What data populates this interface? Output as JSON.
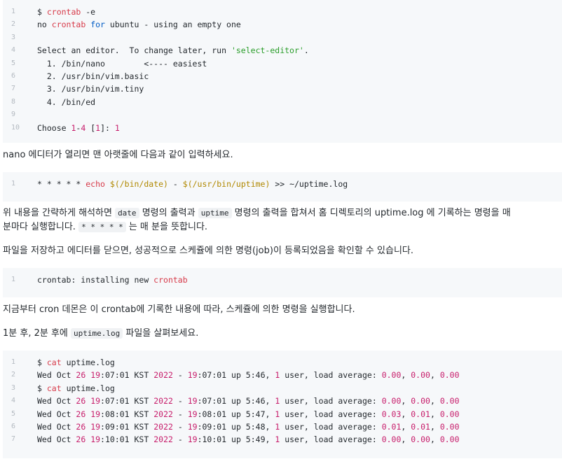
{
  "block1": {
    "lines": [
      {
        "n": "1",
        "parts": [
          {
            "t": "$ ",
            "c": ""
          },
          {
            "t": "crontab",
            "c": "t-kw"
          },
          {
            "t": " -e",
            "c": ""
          }
        ]
      },
      {
        "n": "2",
        "parts": [
          {
            "t": "no ",
            "c": ""
          },
          {
            "t": "crontab",
            "c": "t-kw"
          },
          {
            "t": " ",
            "c": ""
          },
          {
            "t": "for",
            "c": "t-blue"
          },
          {
            "t": " ubuntu - using an empty one",
            "c": ""
          }
        ]
      },
      {
        "n": "3",
        "parts": []
      },
      {
        "n": "4",
        "parts": [
          {
            "t": "Select an editor.  To change later, run ",
            "c": ""
          },
          {
            "t": "'select-editor'",
            "c": "t-str"
          },
          {
            "t": ".",
            "c": ""
          }
        ]
      },
      {
        "n": "5",
        "parts": [
          {
            "t": "  1. /bin/nano        <---- easiest",
            "c": ""
          }
        ]
      },
      {
        "n": "6",
        "parts": [
          {
            "t": "  2. /usr/bin/vim.basic",
            "c": ""
          }
        ]
      },
      {
        "n": "7",
        "parts": [
          {
            "t": "  3. /usr/bin/vim.tiny",
            "c": ""
          }
        ]
      },
      {
        "n": "8",
        "parts": [
          {
            "t": "  4. /bin/ed",
            "c": ""
          }
        ]
      },
      {
        "n": "9",
        "parts": []
      },
      {
        "n": "10",
        "parts": [
          {
            "t": "Choose ",
            "c": ""
          },
          {
            "t": "1",
            "c": "t-num"
          },
          {
            "t": "-",
            "c": ""
          },
          {
            "t": "4",
            "c": "t-num"
          },
          {
            "t": " [",
            "c": ""
          },
          {
            "t": "1",
            "c": "t-num"
          },
          {
            "t": "]: ",
            "c": ""
          },
          {
            "t": "1",
            "c": "t-num"
          }
        ]
      }
    ]
  },
  "para1": "nano 에디터가 열리면 맨 아랫줄에 다음과 같이 입력하세요.",
  "block2": {
    "lines": [
      {
        "n": "1",
        "parts": [
          {
            "t": "* * * * * ",
            "c": ""
          },
          {
            "t": "echo",
            "c": "t-kw"
          },
          {
            "t": " ",
            "c": ""
          },
          {
            "t": "$(/bin/date)",
            "c": "t-var"
          },
          {
            "t": " - ",
            "c": ""
          },
          {
            "t": "$(/usr/bin/uptime)",
            "c": "t-var"
          },
          {
            "t": " >> ~/uptime.log",
            "c": ""
          }
        ]
      }
    ]
  },
  "para2": {
    "a": "위 내용을 간략하게 해석하면",
    "code1": "date",
    "b": "명령의 출력과",
    "code2": "uptime",
    "c": "명령의 출력을 합쳐서 홈 디렉토리의 uptime.log 에 기록하는 명령을 매",
    "d": "분마다 실행합니다.",
    "code3": "* * * * *",
    "e": "는 매 분을 뜻합니다."
  },
  "para3": "파일을 저장하고 에디터를 닫으면, 성공적으로 스케쥴에 의한 명령(job)이 등록되었음을 확인할 수 있습니다.",
  "block3": {
    "lines": [
      {
        "n": "1",
        "parts": [
          {
            "t": "crontab: installing new ",
            "c": ""
          },
          {
            "t": "crontab",
            "c": "t-kw"
          }
        ]
      }
    ]
  },
  "para4": "지금부터 cron 데몬은 이 crontab에 기록한 내용에 따라, 스케쥴에 의한 명령을 실행합니다.",
  "para5": {
    "a": "1분 후, 2분 후에",
    "code": "uptime.log",
    "b": "파일을 살펴보세요."
  },
  "block4": {
    "lines": [
      {
        "n": "1",
        "parts": [
          {
            "t": "$ ",
            "c": ""
          },
          {
            "t": "cat",
            "c": "t-kw"
          },
          {
            "t": " uptime.log",
            "c": ""
          }
        ]
      },
      {
        "n": "2",
        "parts": [
          {
            "t": "Wed Oct ",
            "c": ""
          },
          {
            "t": "26",
            "c": "t-num"
          },
          {
            "t": " ",
            "c": ""
          },
          {
            "t": "19",
            "c": "t-num"
          },
          {
            "t": ":07:01 KST ",
            "c": ""
          },
          {
            "t": "2022",
            "c": "t-num"
          },
          {
            "t": " - ",
            "c": ""
          },
          {
            "t": "19",
            "c": "t-num"
          },
          {
            "t": ":07:01 up 5:46, ",
            "c": ""
          },
          {
            "t": "1",
            "c": "t-num"
          },
          {
            "t": " user, load average: ",
            "c": ""
          },
          {
            "t": "0.00",
            "c": "t-num"
          },
          {
            "t": ", ",
            "c": ""
          },
          {
            "t": "0.00",
            "c": "t-num"
          },
          {
            "t": ", ",
            "c": ""
          },
          {
            "t": "0.00",
            "c": "t-num"
          }
        ]
      },
      {
        "n": "3",
        "parts": [
          {
            "t": "$ ",
            "c": ""
          },
          {
            "t": "cat",
            "c": "t-kw"
          },
          {
            "t": " uptime.log",
            "c": ""
          }
        ]
      },
      {
        "n": "4",
        "parts": [
          {
            "t": "Wed Oct ",
            "c": ""
          },
          {
            "t": "26",
            "c": "t-num"
          },
          {
            "t": " ",
            "c": ""
          },
          {
            "t": "19",
            "c": "t-num"
          },
          {
            "t": ":07:01 KST ",
            "c": ""
          },
          {
            "t": "2022",
            "c": "t-num"
          },
          {
            "t": " - ",
            "c": ""
          },
          {
            "t": "19",
            "c": "t-num"
          },
          {
            "t": ":07:01 up 5:46, ",
            "c": ""
          },
          {
            "t": "1",
            "c": "t-num"
          },
          {
            "t": " user, load average: ",
            "c": ""
          },
          {
            "t": "0.00",
            "c": "t-num"
          },
          {
            "t": ", ",
            "c": ""
          },
          {
            "t": "0.00",
            "c": "t-num"
          },
          {
            "t": ", ",
            "c": ""
          },
          {
            "t": "0.00",
            "c": "t-num"
          }
        ]
      },
      {
        "n": "5",
        "parts": [
          {
            "t": "Wed Oct ",
            "c": ""
          },
          {
            "t": "26",
            "c": "t-num"
          },
          {
            "t": " ",
            "c": ""
          },
          {
            "t": "19",
            "c": "t-num"
          },
          {
            "t": ":08:01 KST ",
            "c": ""
          },
          {
            "t": "2022",
            "c": "t-num"
          },
          {
            "t": " - ",
            "c": ""
          },
          {
            "t": "19",
            "c": "t-num"
          },
          {
            "t": ":08:01 up 5:47, ",
            "c": ""
          },
          {
            "t": "1",
            "c": "t-num"
          },
          {
            "t": " user, load average: ",
            "c": ""
          },
          {
            "t": "0.03",
            "c": "t-num"
          },
          {
            "t": ", ",
            "c": ""
          },
          {
            "t": "0.01",
            "c": "t-num"
          },
          {
            "t": ", ",
            "c": ""
          },
          {
            "t": "0.00",
            "c": "t-num"
          }
        ]
      },
      {
        "n": "6",
        "parts": [
          {
            "t": "Wed Oct ",
            "c": ""
          },
          {
            "t": "26",
            "c": "t-num"
          },
          {
            "t": " ",
            "c": ""
          },
          {
            "t": "19",
            "c": "t-num"
          },
          {
            "t": ":09:01 KST ",
            "c": ""
          },
          {
            "t": "2022",
            "c": "t-num"
          },
          {
            "t": " - ",
            "c": ""
          },
          {
            "t": "19",
            "c": "t-num"
          },
          {
            "t": ":09:01 up 5:48, ",
            "c": ""
          },
          {
            "t": "1",
            "c": "t-num"
          },
          {
            "t": " user, load average: ",
            "c": ""
          },
          {
            "t": "0.01",
            "c": "t-num"
          },
          {
            "t": ", ",
            "c": ""
          },
          {
            "t": "0.01",
            "c": "t-num"
          },
          {
            "t": ", ",
            "c": ""
          },
          {
            "t": "0.00",
            "c": "t-num"
          }
        ]
      },
      {
        "n": "7",
        "parts": [
          {
            "t": "Wed Oct ",
            "c": ""
          },
          {
            "t": "26",
            "c": "t-num"
          },
          {
            "t": " ",
            "c": ""
          },
          {
            "t": "19",
            "c": "t-num"
          },
          {
            "t": ":10:01 KST ",
            "c": ""
          },
          {
            "t": "2022",
            "c": "t-num"
          },
          {
            "t": " - ",
            "c": ""
          },
          {
            "t": "19",
            "c": "t-num"
          },
          {
            "t": ":10:01 up 5:49, ",
            "c": ""
          },
          {
            "t": "1",
            "c": "t-num"
          },
          {
            "t": " user, load average: ",
            "c": ""
          },
          {
            "t": "0.00",
            "c": "t-num"
          },
          {
            "t": ", ",
            "c": ""
          },
          {
            "t": "0.00",
            "c": "t-num"
          },
          {
            "t": ", ",
            "c": ""
          },
          {
            "t": "0.00",
            "c": "t-num"
          }
        ]
      }
    ]
  }
}
